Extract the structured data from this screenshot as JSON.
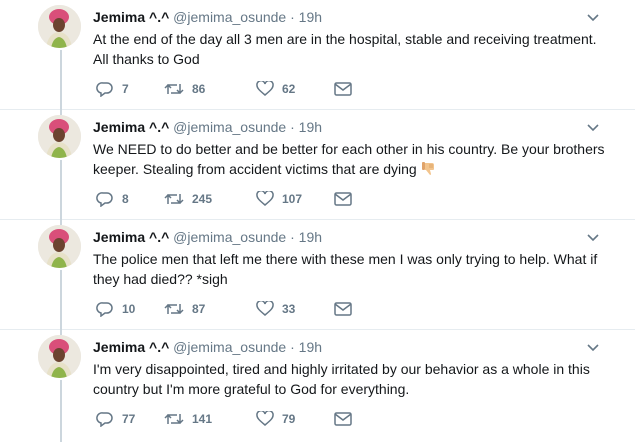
{
  "tweets": [
    {
      "name": "Jemima ^.^",
      "handle": "@jemima_osunde",
      "separator": "·",
      "time": "19h",
      "text": "At the end of the day all 3 men are in the hospital, stable and receiving treatment. All thanks to God",
      "emoji": "",
      "replies": "7",
      "retweets": "86",
      "likes": "62"
    },
    {
      "name": "Jemima ^.^",
      "handle": "@jemima_osunde",
      "separator": "·",
      "time": "19h",
      "text": "We NEED to do better and be better for each other in his country. Be your brothers keeper. Stealing from accident victims that are dying",
      "emoji": "thumbs-down-icon",
      "replies": "8",
      "retweets": "245",
      "likes": "107"
    },
    {
      "name": "Jemima ^.^",
      "handle": "@jemima_osunde",
      "separator": "·",
      "time": "19h",
      "text": "The police men that left me there with these men I was only trying to help. What if they had died?? *sigh",
      "emoji": "",
      "replies": "10",
      "retweets": "87",
      "likes": "33"
    },
    {
      "name": "Jemima ^.^",
      "handle": "@jemima_osunde",
      "separator": "·",
      "time": "19h",
      "text": "I'm very disappointed, tired and highly irritated by our behavior as a whole in this country but I'm more grateful to God for everything.",
      "emoji": "",
      "replies": "77",
      "retweets": "141",
      "likes": "79"
    }
  ],
  "colors": {
    "text": "#14171a",
    "muted": "#657786",
    "thread_line": "#ccd6dd",
    "divider": "#e6ecf0",
    "avatar_headwrap": "#d94f7a"
  }
}
